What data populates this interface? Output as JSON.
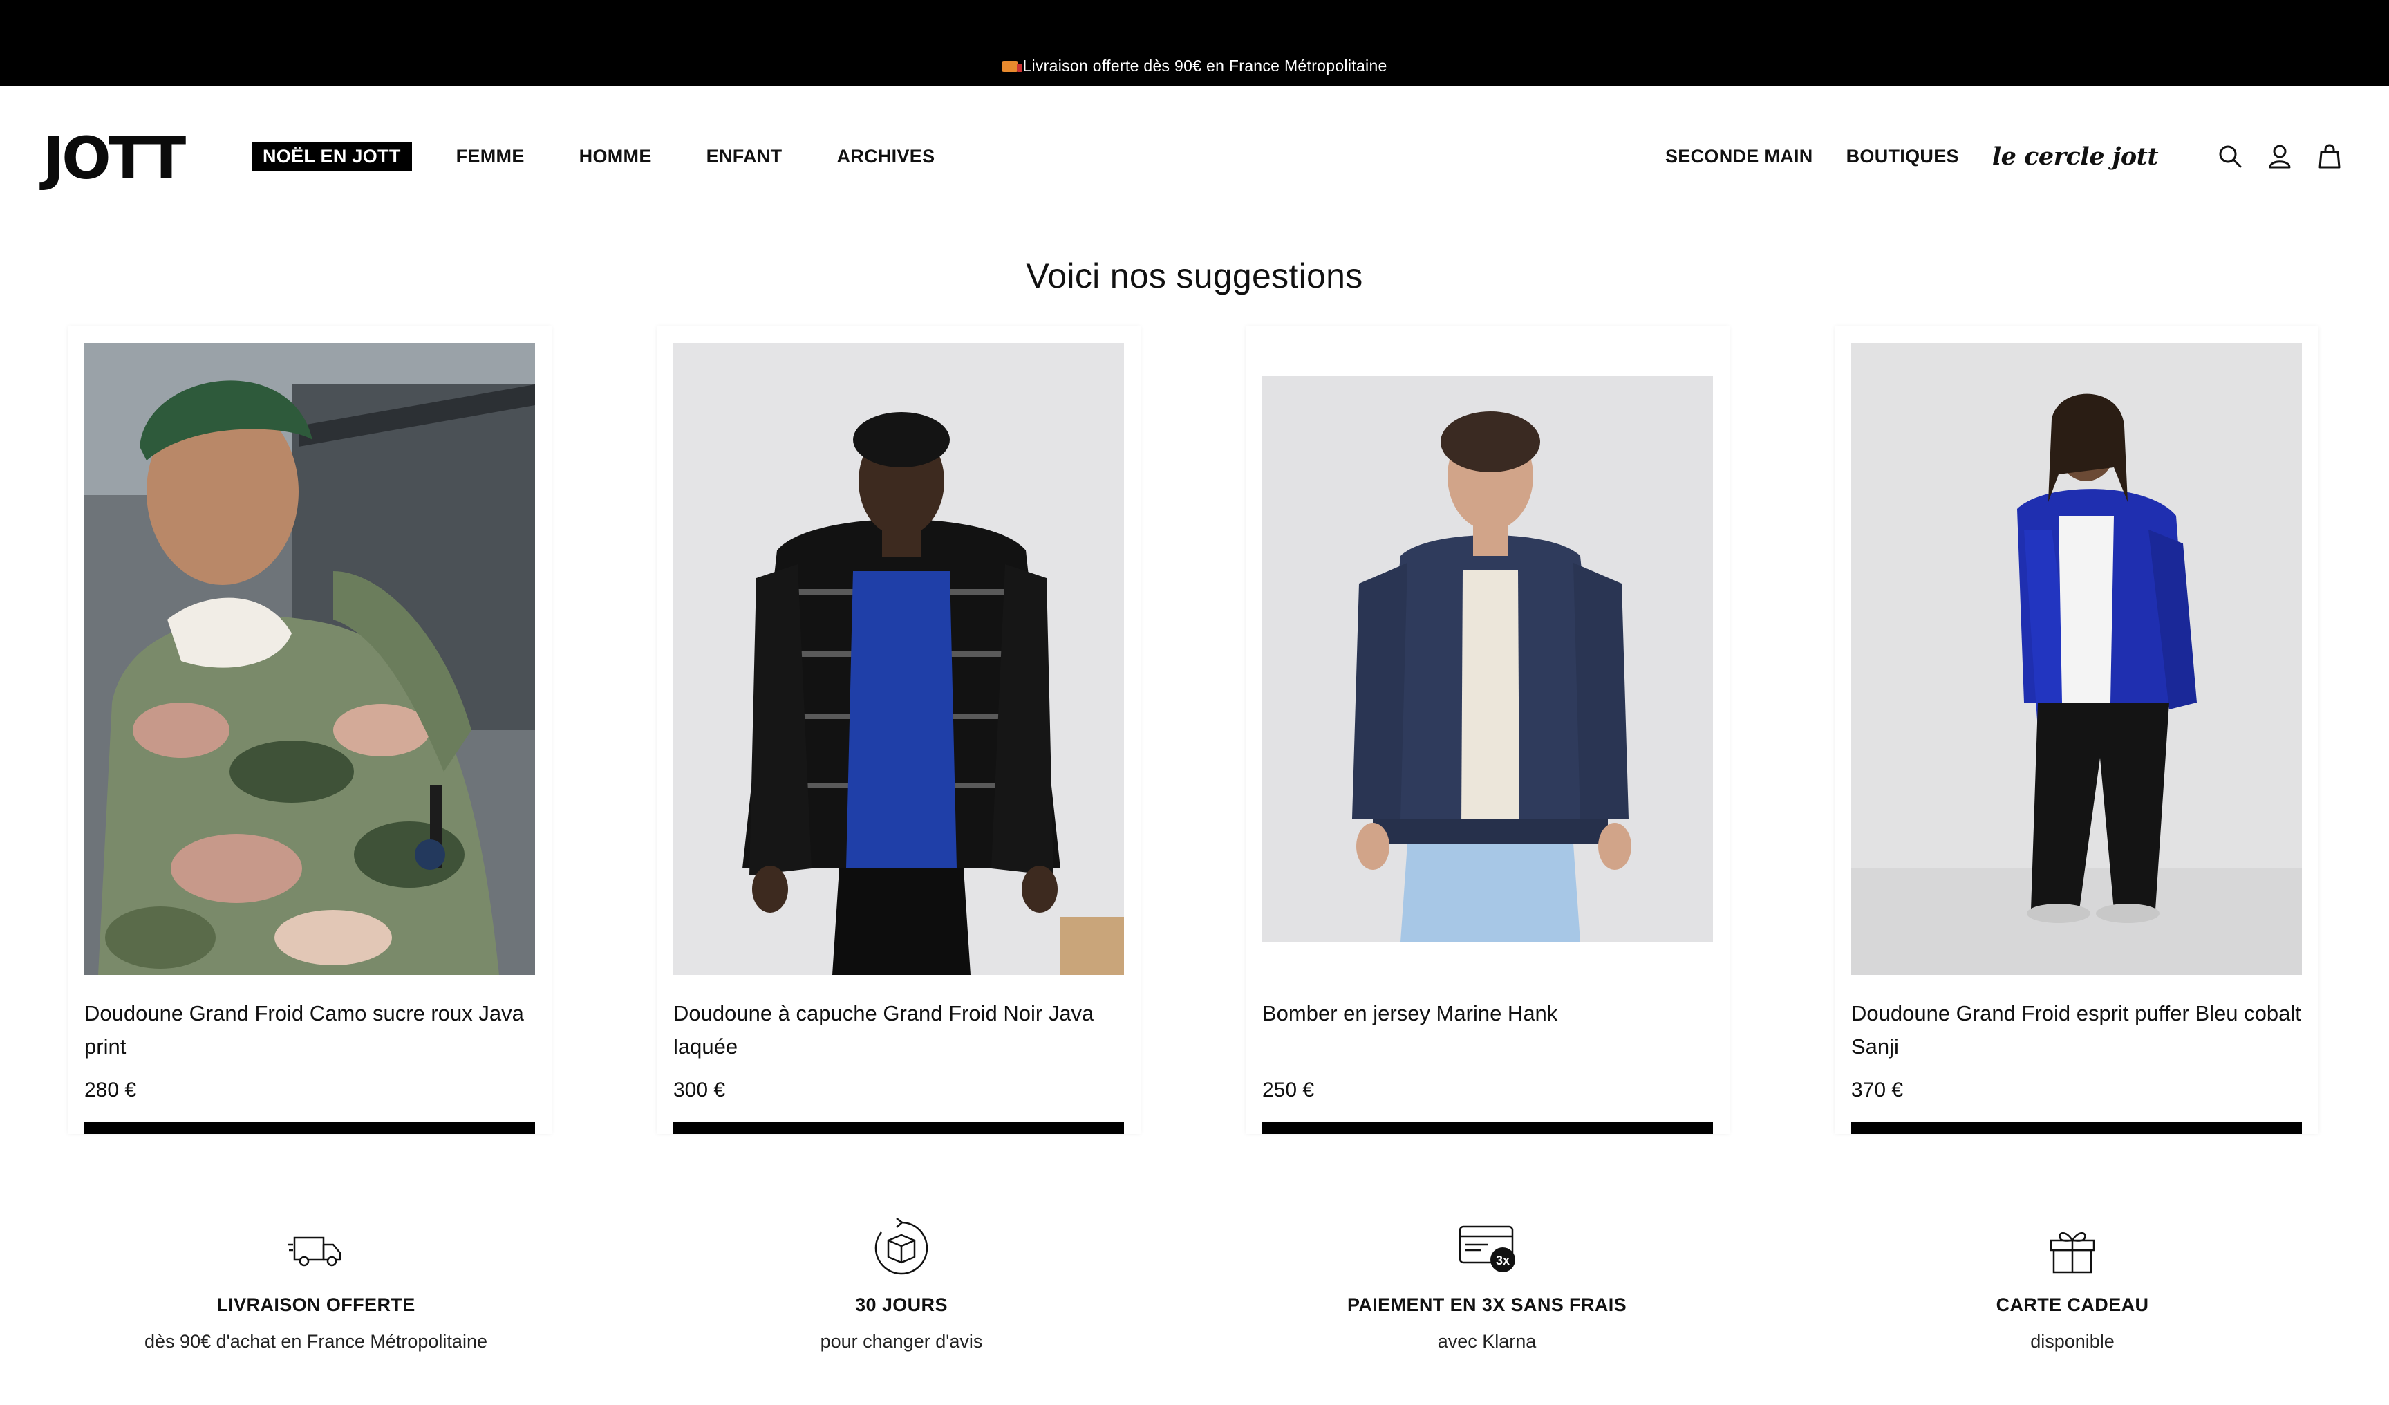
{
  "announcement": {
    "text": "Livraison offerte dès 90€ en France Métropolitaine"
  },
  "header": {
    "logo": "JOTT",
    "nav": [
      {
        "label": "NOËL EN JOTT"
      },
      {
        "label": "FEMME"
      },
      {
        "label": "HOMME"
      },
      {
        "label": "ENFANT"
      },
      {
        "label": "ARCHIVES"
      }
    ],
    "right_links": [
      {
        "label": "SECONDE MAIN"
      },
      {
        "label": "BOUTIQUES"
      }
    ],
    "club_logo": "le cercle jott",
    "icons": [
      "search-icon",
      "account-icon",
      "cart-icon"
    ]
  },
  "suggestions": {
    "title": "Voici nos suggestions",
    "products": [
      {
        "name": "Doudoune Grand Froid Camo sucre roux Java print",
        "price": "280 €"
      },
      {
        "name": "Doudoune à capuche Grand Froid Noir Java laquée",
        "price": "300 €"
      },
      {
        "name": "Bomber en jersey Marine Hank",
        "price": "250 €"
      },
      {
        "name": "Doudoune Grand Froid esprit puffer Bleu cobalt Sanji",
        "price": "370 €"
      }
    ]
  },
  "benefits": [
    {
      "icon": "truck-icon",
      "title": "LIVRAISON OFFERTE",
      "subtitle": "dès 90€ d'achat en France Métropolitaine"
    },
    {
      "icon": "return-box-icon",
      "title": "30 JOURS",
      "subtitle": "pour changer d'avis"
    },
    {
      "icon": "card-3x-icon",
      "title": "PAIEMENT EN 3X SANS FRAIS",
      "subtitle": "avec Klarna"
    },
    {
      "icon": "gift-icon",
      "title": "CARTE CADEAU",
      "subtitle": "disponible"
    }
  ],
  "colors": {
    "topbar": "#000000",
    "accent": "#000000",
    "background": "#ffffff",
    "photo_background": "#e6e6e8"
  }
}
